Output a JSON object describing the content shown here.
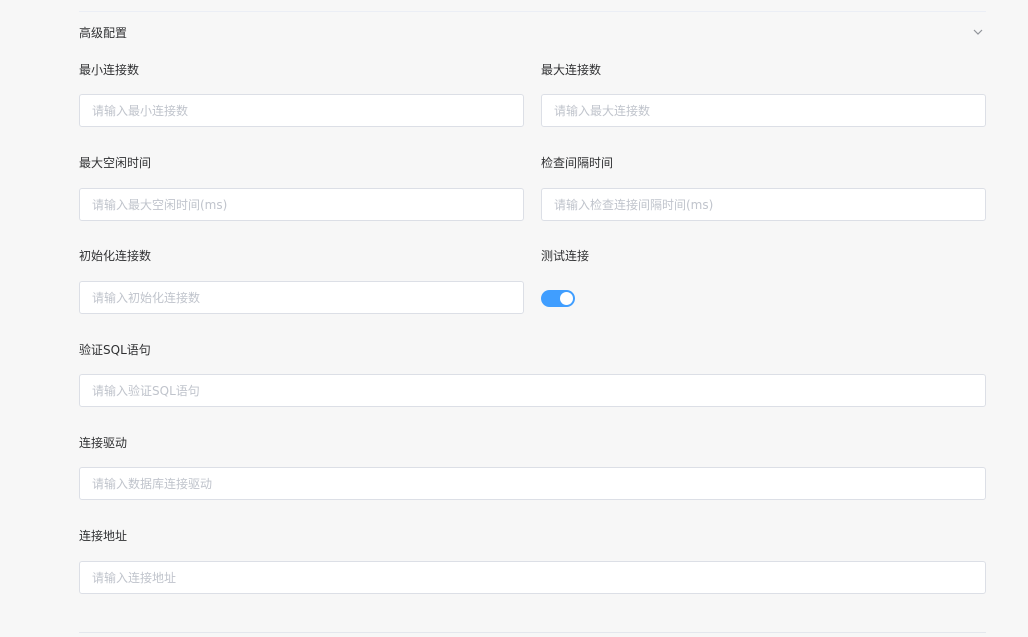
{
  "section": {
    "title": "高级配置",
    "collapse_icon": "chevron-down-icon"
  },
  "fields": {
    "min_connections": {
      "label": "最小连接数",
      "placeholder": "请输入最小连接数",
      "value": ""
    },
    "max_connections": {
      "label": "最大连接数",
      "placeholder": "请输入最大连接数",
      "value": ""
    },
    "max_idle_time": {
      "label": "最大空闲时间",
      "placeholder": "请输入最大空闲时间(ms)",
      "value": ""
    },
    "check_interval": {
      "label": "检查间隔时间",
      "placeholder": "请输入检查连接间隔时间(ms)",
      "value": ""
    },
    "initial_connections": {
      "label": "初始化连接数",
      "placeholder": "请输入初始化连接数",
      "value": ""
    },
    "test_connection": {
      "label": "测试连接",
      "enabled": true
    },
    "validation_sql": {
      "label": "验证SQL语句",
      "placeholder": "请输入验证SQL语句",
      "value": ""
    },
    "driver": {
      "label": "连接驱动",
      "placeholder": "请输入数据库连接驱动",
      "value": ""
    },
    "url": {
      "label": "连接地址",
      "placeholder": "请输入连接地址",
      "value": ""
    }
  },
  "colors": {
    "accent": "#409eff",
    "border": "#dcdfe6",
    "placeholder": "#c0c4cc",
    "background": "#f7f7f7"
  }
}
